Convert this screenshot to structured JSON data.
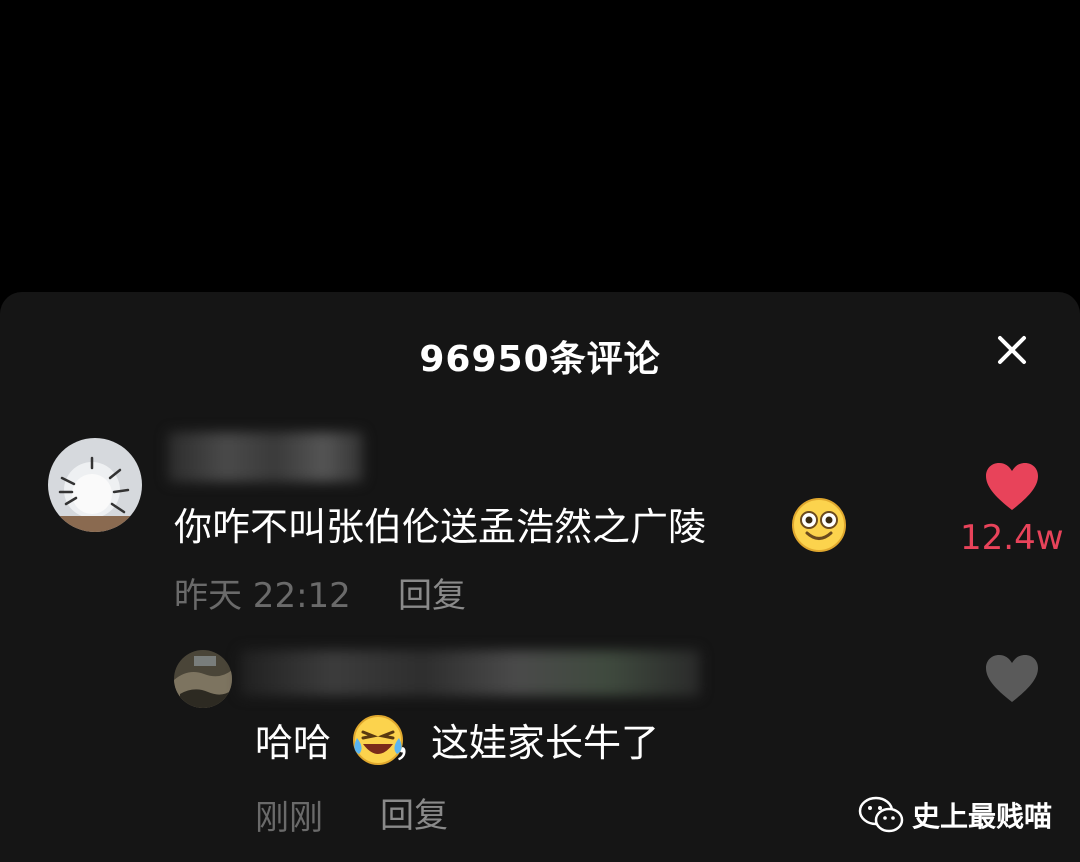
{
  "sheet": {
    "title": "96950条评论"
  },
  "comments": [
    {
      "text": "你咋不叫张伯伦送孟浩然之广陵",
      "emoji": "smiling-face-icon",
      "time": "昨天 22:12",
      "reply_label": "回复",
      "likes": "12.4w",
      "liked": true
    }
  ],
  "replies": [
    {
      "text_before": "哈哈",
      "emoji": "tears-of-joy-face-icon",
      "text_after": "，这娃家长牛了",
      "time": "刚刚",
      "reply_label": "回复",
      "liked": false
    }
  ],
  "watermark": {
    "text": "史上最贱喵"
  },
  "colors": {
    "background": "#000000",
    "sheet": "#151515",
    "like_active": "#e8435a",
    "like_inactive": "#5a5a5a",
    "meta": "#6a6a6a"
  }
}
